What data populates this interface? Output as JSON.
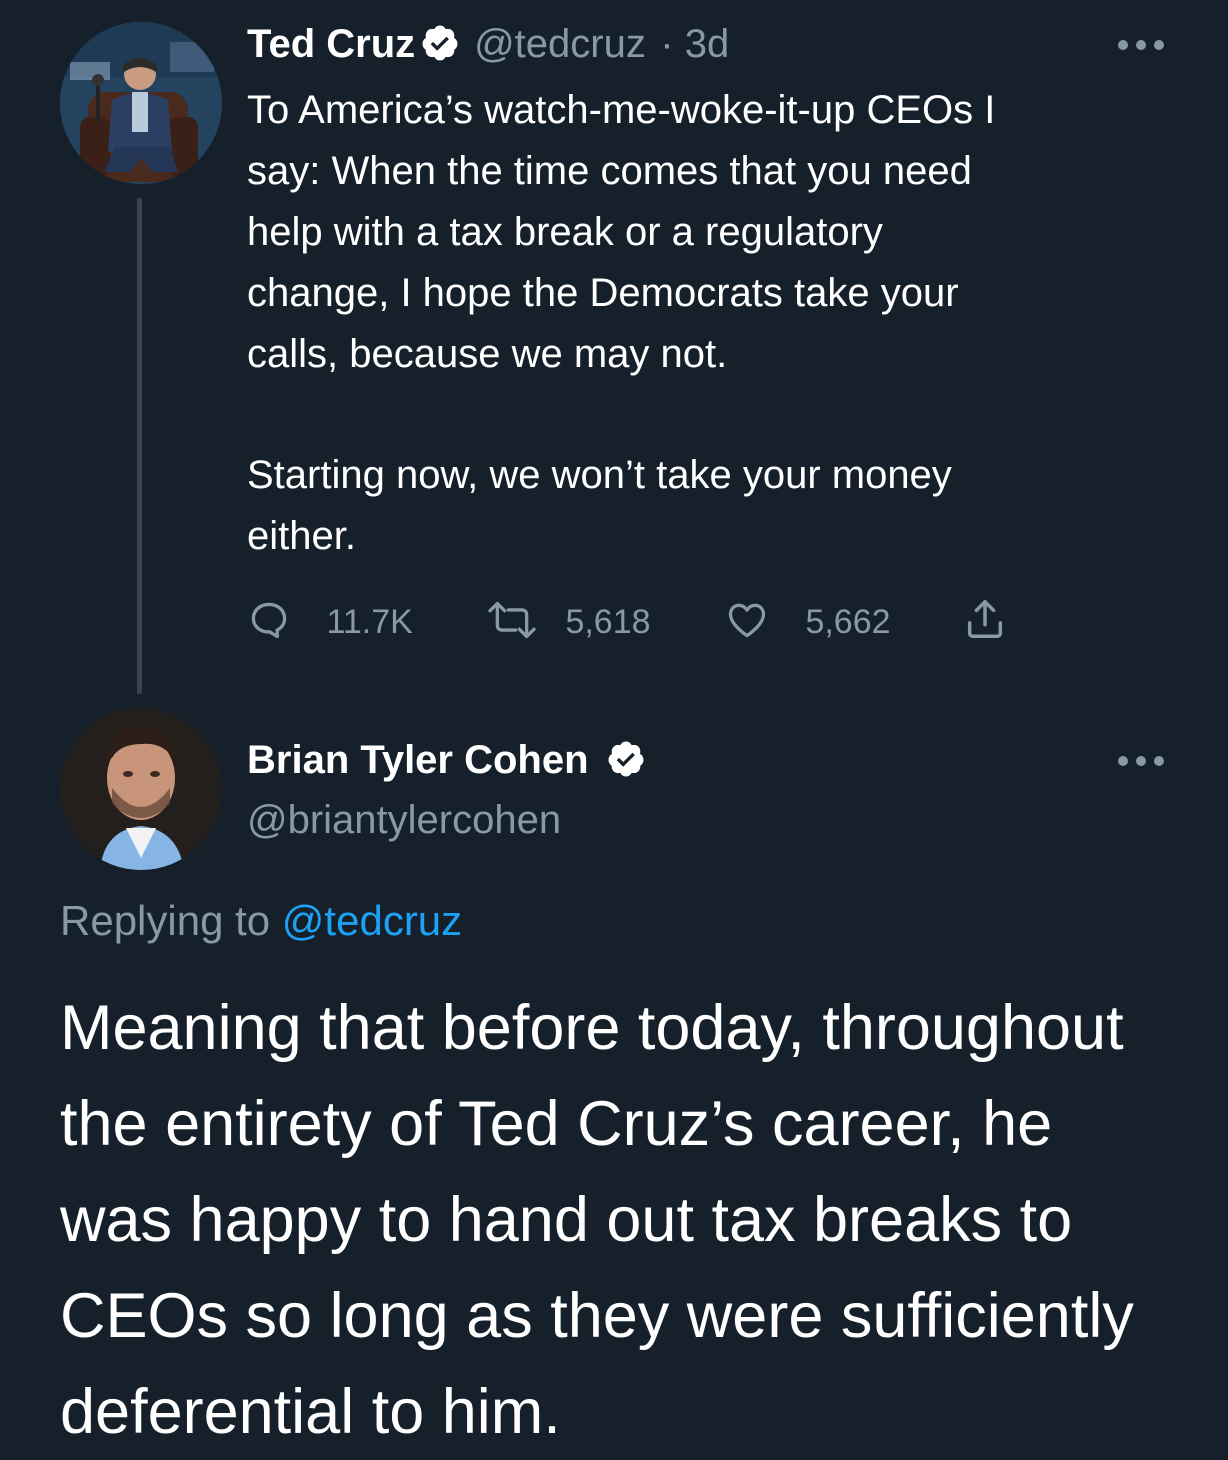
{
  "tweet1": {
    "author_name": "Ted Cruz",
    "handle": "@tedcruz",
    "timestamp": "· 3d",
    "text_para1": "To America’s watch-me-woke-it-up CEOs I\nsay: When the time comes that you need\nhelp with a tax break or a regulatory\nchange, I hope the Democrats take your\ncalls, because we may not.",
    "text_para2": "Starting now, we won’t take your money\neither.",
    "replies": "11.7K",
    "retweets": "5,618",
    "likes": "5,662",
    "more_icon": "more-icon",
    "verified_icon": "verified-badge-icon"
  },
  "tweet2": {
    "author_name": "Brian Tyler Cohen",
    "handle": "@briantylercohen",
    "replying_prefix": "Replying to",
    "replying_to": "@tedcruz",
    "text": "Meaning that before today, throughout\nthe entirety of Ted Cruz’s career, he\nwas happy to hand out tax breaks to\nCEOs so long as they were sufficiently\ndeferential to him."
  },
  "colors": {
    "background": "#15202b",
    "secondary_text": "#8899a6",
    "accent": "#1da1f2",
    "thread_line": "#38444d"
  }
}
